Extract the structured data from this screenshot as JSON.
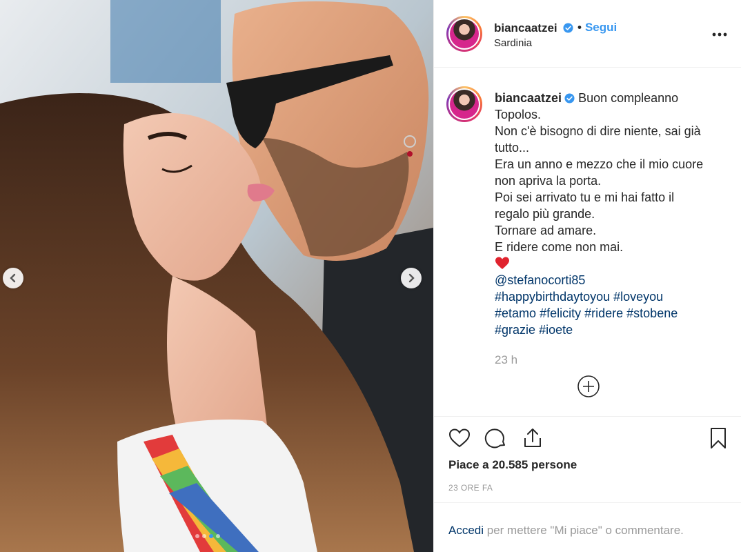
{
  "post": {
    "username": "biancaatzei",
    "follow_separator": "•",
    "follow_label": "Segui",
    "location": "Sardinia",
    "caption_lines": [
      "Buon compleanno",
      "Topolos.",
      "Non c'è bisogno di dire niente, sai già",
      "tutto...",
      "Era un anno e mezzo che il mio cuore",
      "non apriva la porta.",
      "Poi sei arrivato tu e mi hai fatto il",
      "regalo più grande.",
      "Tornare ad amare.",
      "E ridere come non mai."
    ],
    "mention": "@stefanocorti85",
    "hashtag_lines": [
      [
        "#happybirthdaytoyou",
        "#loveyou"
      ],
      [
        "#etamo",
        "#felicity",
        "#ridere",
        "#stobene"
      ],
      [
        "#grazie",
        "#ioete"
      ]
    ],
    "comment_time": "23 h",
    "likes_text": "Piace a 20.585 persone",
    "posted_time": "23 ORE FA",
    "login_prompt": {
      "link": "Accedi",
      "rest": " per mettere \"Mi piace\" o commentare."
    }
  },
  "carousel": {
    "total": 4,
    "active_index": 2
  },
  "icons": {
    "verified": "verified-badge-icon",
    "more": "more-options-icon",
    "like": "heart-icon",
    "comment": "comment-icon",
    "share": "share-icon",
    "save": "bookmark-icon",
    "load_more": "plus-circle-icon",
    "emoji": "red-heart-emoji-icon",
    "prev": "chevron-left-icon",
    "next": "chevron-right-icon"
  },
  "colors": {
    "link": "#003569",
    "accent": "#3897f0",
    "muted": "#999999",
    "verified": "#3897f0"
  }
}
